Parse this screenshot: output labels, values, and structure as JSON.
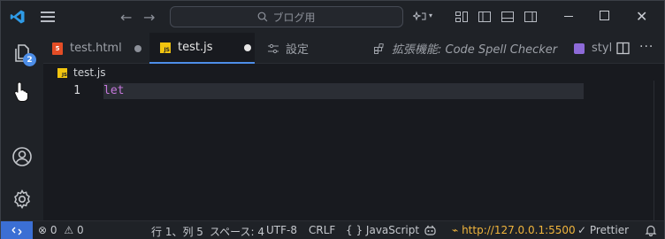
{
  "titlebar": {
    "search_placeholder": "ブログ用",
    "colors": {
      "accent": "#4d8ee8",
      "background": "#1f2227"
    }
  },
  "activity": {
    "explorer_badge": "2"
  },
  "tabs": [
    {
      "label": "test.html",
      "icon": "html5-icon",
      "dirty": true
    },
    {
      "label": "test.js",
      "icon": "javascript-icon",
      "dirty": true,
      "active": true
    },
    {
      "label": "設定",
      "icon": "settings-sliders-icon"
    },
    {
      "label": "拡張機能: Code Spell Checker",
      "icon": "extensions-icon"
    },
    {
      "label": "styl",
      "icon": "css-icon"
    }
  ],
  "breadcrumb": {
    "file": "test.js"
  },
  "editor": {
    "line_number": "1",
    "code": "let"
  },
  "statusbar": {
    "remote_icon": "remote-icon",
    "errors": "0",
    "warnings": "0",
    "position": "行 1、列 5",
    "spaces": "スペース: 4",
    "encoding": "UTF-8",
    "eol": "CRLF",
    "language": "JavaScript",
    "live_server": "http://127.0.0.1:5500",
    "prettier": "Prettier"
  }
}
